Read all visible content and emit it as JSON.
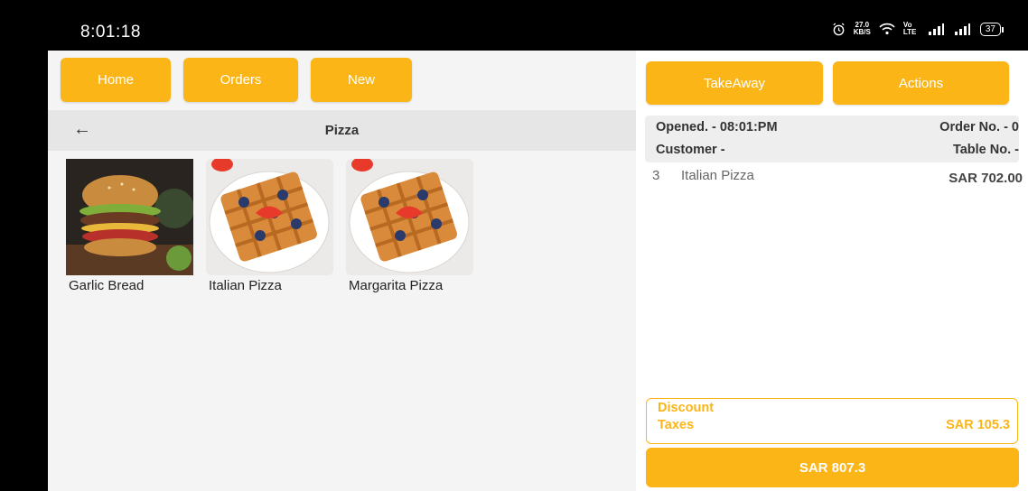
{
  "status_bar": {
    "time": "8:01:18",
    "net_speed_top": "27.0",
    "net_speed_unit": "KB/S",
    "volte": "Vo LTE",
    "battery": "37"
  },
  "nav": {
    "home": "Home",
    "orders": "Orders",
    "new": "New"
  },
  "category": {
    "title": "Pizza"
  },
  "products": [
    {
      "name": "Garlic Bread"
    },
    {
      "name": "Italian Pizza"
    },
    {
      "name": "Margarita Pizza"
    }
  ],
  "order_actions": {
    "takeaway": "TakeAway",
    "actions": "Actions"
  },
  "order_header": {
    "opened": "Opened. - 08:01:PM",
    "order_no": "Order No. - 0",
    "customer": "Customer -",
    "table_no": "Table No. -"
  },
  "order_items": [
    {
      "qty": "3",
      "name": "Italian Pizza",
      "price": "SAR 702.00"
    }
  ],
  "summary": {
    "discount_label": "Discount",
    "taxes_label": "Taxes",
    "taxes_value": "SAR 105.3"
  },
  "total": "SAR 807.3",
  "colors": {
    "accent": "#fbb516",
    "panel_bg": "#f4f4f4",
    "status_bar": "#000000"
  }
}
